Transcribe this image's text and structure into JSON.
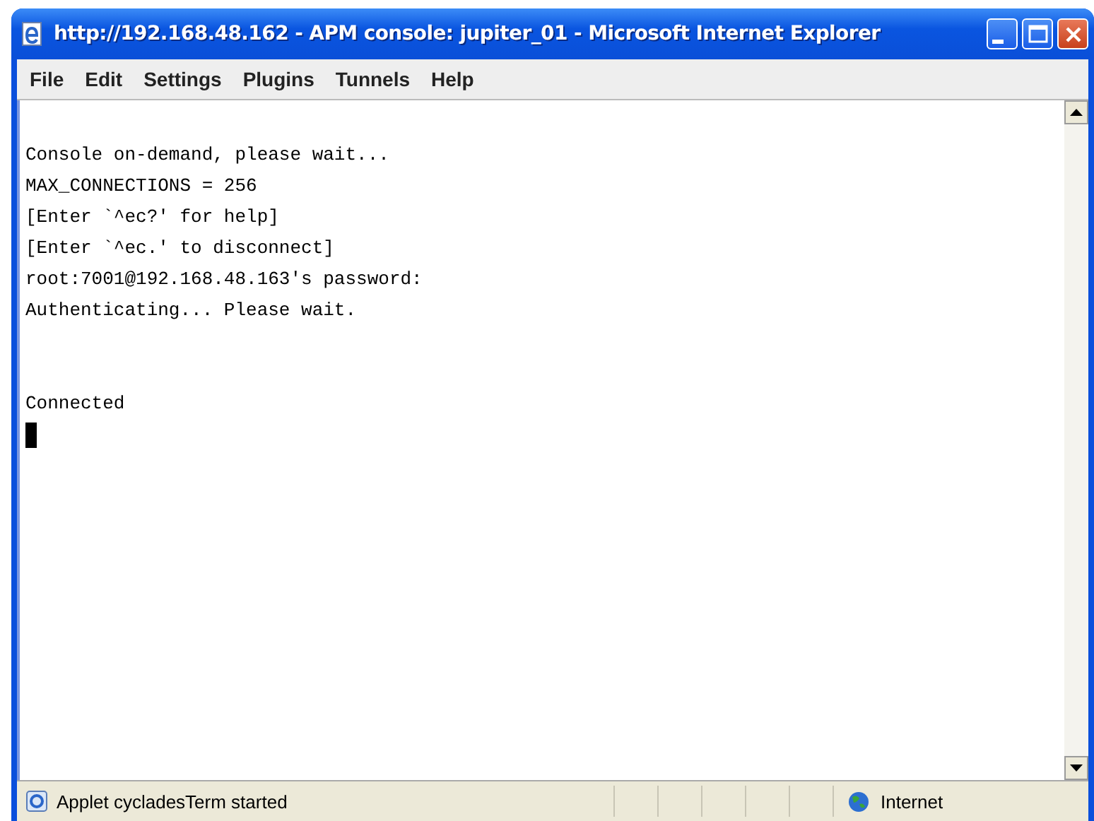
{
  "window": {
    "title": "http://192.168.48.162 - APM console: jupiter_01 - Microsoft Internet Explorer"
  },
  "menu": [
    "File",
    "Edit",
    "Settings",
    "Plugins",
    "Tunnels",
    "Help"
  ],
  "terminal": {
    "blocks": [
      {
        "lines": [
          "Console on-demand, please wait...",
          "MAX_CONNECTIONS = 256",
          "[Enter `^ec?' for help]",
          "[Enter `^ec.' to disconnect]",
          "root:7001@192.168.48.163's password:",
          "Authenticating... Please wait."
        ]
      },
      {
        "lines": [
          "Connected"
        ]
      }
    ],
    "cursor": true
  },
  "status_bar": {
    "message": "Applet cycladesTerm started",
    "zone": "Internet"
  }
}
